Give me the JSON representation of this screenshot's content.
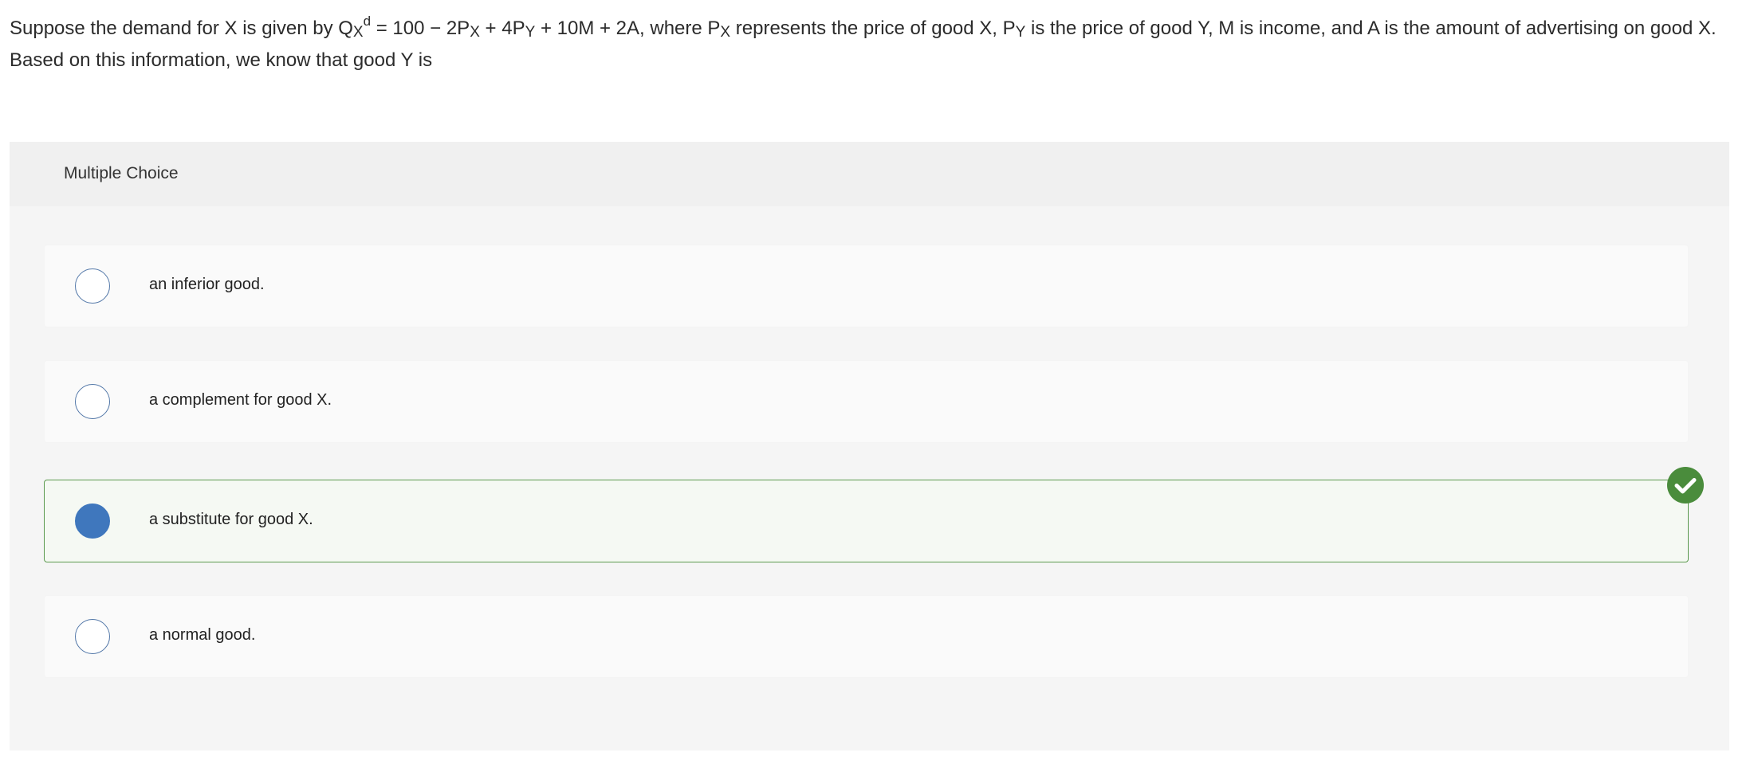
{
  "question": {
    "part1": "Suppose the demand for X is given by Q",
    "sub_x1": "X",
    "sup_d": "d",
    "part2": " = 100 − 2P",
    "sub_x2": "X",
    "part3": " + 4P",
    "sub_y1": "Y",
    "part4": " + 10M + 2A, where P",
    "sub_x3": "X",
    "part5": " represents the price of good X, P",
    "sub_y2": "Y",
    "part6": " is the price of good Y, M is income, and A is the amount of advertising on good X. Based on this information, we know that good Y is"
  },
  "multiple_choice": {
    "title": "Multiple Choice",
    "options": [
      {
        "label": "an inferior good.",
        "selected": false
      },
      {
        "label": "a complement for good X.",
        "selected": false
      },
      {
        "label": "a substitute for good X.",
        "selected": true
      },
      {
        "label": "a normal good.",
        "selected": false
      }
    ],
    "correct_icon": "check-circle-icon",
    "colors": {
      "selected_radio": "#3f77bd",
      "correct_green": "#4a8c3c"
    }
  }
}
